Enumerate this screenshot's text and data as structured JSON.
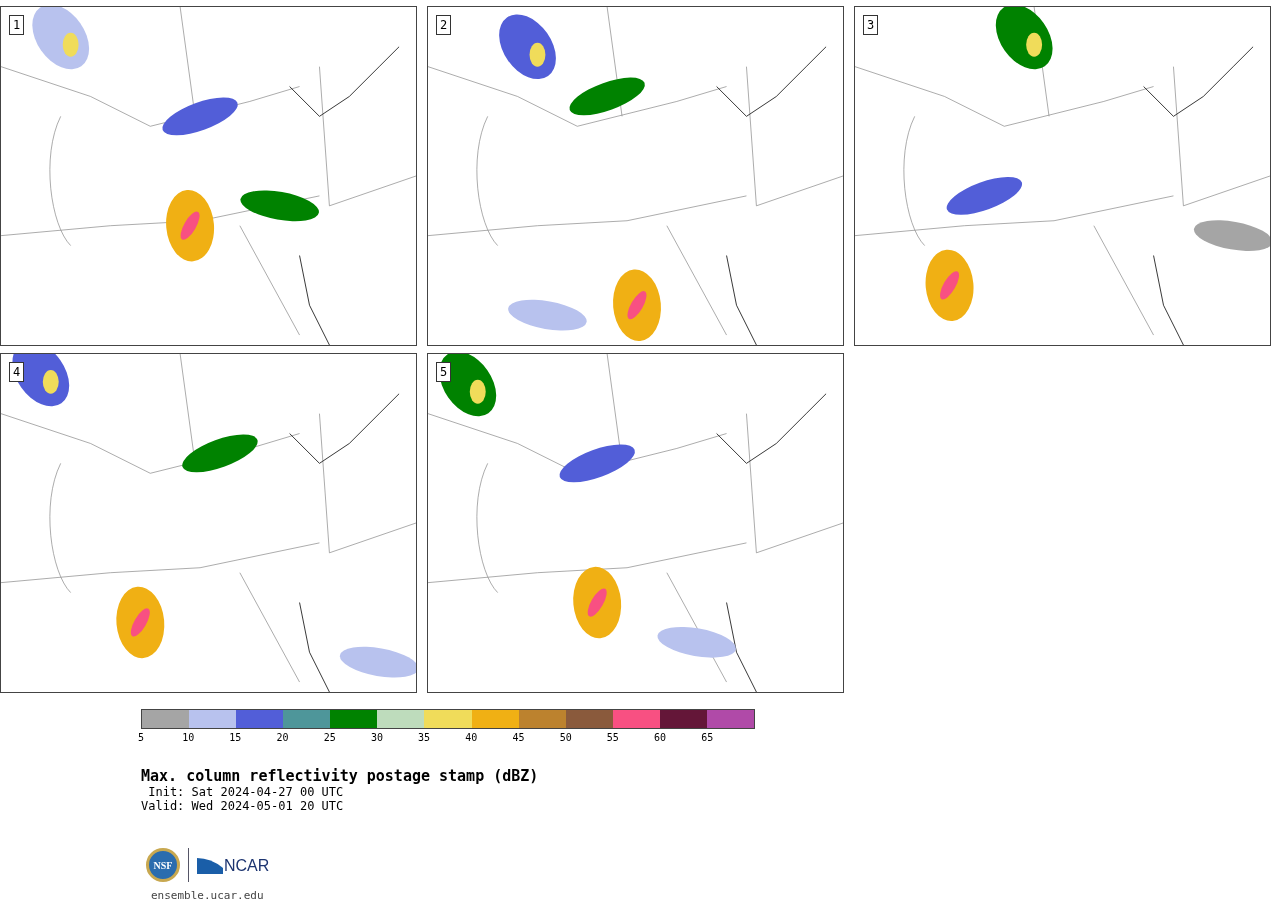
{
  "panels": [
    {
      "number": "1"
    },
    {
      "number": "2"
    },
    {
      "number": "3"
    },
    {
      "number": "4"
    },
    {
      "number": "5"
    }
  ],
  "colorbar": {
    "segments": [
      {
        "color": "#a5a5a5"
      },
      {
        "color": "#b8c2ee"
      },
      {
        "color": "#525ed8"
      },
      {
        "color": "#4e969a"
      },
      {
        "color": "#008200"
      },
      {
        "color": "#bedcbc"
      },
      {
        "color": "#f0dc5a"
      },
      {
        "color": "#f0b014"
      },
      {
        "color": "#bc822e"
      },
      {
        "color": "#8a5a3c"
      },
      {
        "color": "#f85082"
      },
      {
        "color": "#641638"
      },
      {
        "color": "#b04aa8"
      }
    ],
    "ticks": [
      "5",
      "10",
      "15",
      "20",
      "25",
      "30",
      "35",
      "40",
      "45",
      "50",
      "55",
      "60",
      "65"
    ]
  },
  "title": "Max. column reflectivity postage stamp (dBZ)",
  "init": " Init: Sat 2024-04-27 00 UTC",
  "valid": "Valid: Wed 2024-05-01 20 UTC",
  "logos": {
    "nsf": "NSF",
    "ncar": "NCAR"
  },
  "footer": "ensemble.ucar.edu"
}
